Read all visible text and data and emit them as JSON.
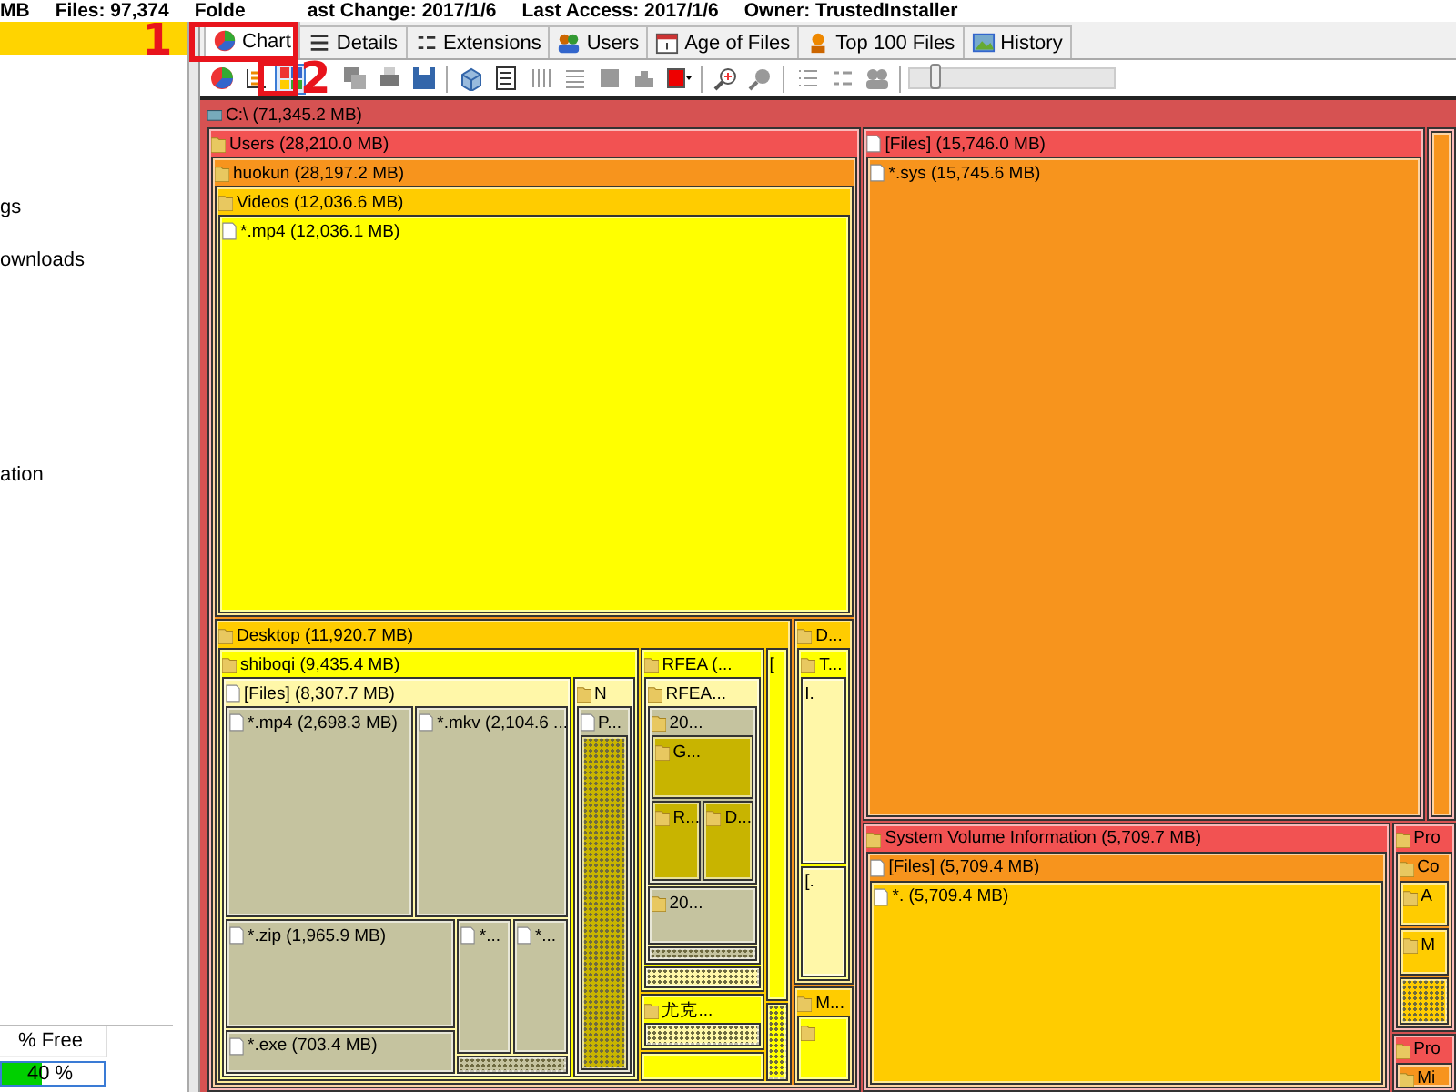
{
  "info_bar": [
    "MB",
    "Files: 97,374",
    "Folde",
    "ast Change: 2017/1/6",
    "Last Access: 2017/1/6",
    "Owner: TrustedInstaller"
  ],
  "sidebar": {
    "items": [
      {
        "selected": true
      },
      {
        "label": "gs",
        "selected": false
      },
      {
        "label": "ownloads",
        "selected": false
      },
      {
        "label": "ation",
        "selected": false
      }
    ]
  },
  "drives": {
    "column": "% Free",
    "rows": [
      {
        "reading": "40 %",
        "level": 0.4
      }
    ]
  },
  "tabs": [
    {
      "label": "Chart",
      "selected": true
    },
    {
      "label": "Details",
      "selected": false
    },
    {
      "label": "Extensions",
      "selected": false
    },
    {
      "label": "Users",
      "selected": false
    },
    {
      "label": "Age of Files",
      "selected": false
    },
    {
      "label": "Top 100 Files",
      "selected": false
    },
    {
      "label": "History",
      "selected": false
    }
  ],
  "toolbar": [
    {
      "kind": "button",
      "selected": false
    },
    {
      "kind": "button",
      "selected": false
    },
    {
      "kind": "button",
      "selected": true
    },
    {
      "kind": "button",
      "selected": false
    },
    {
      "kind": "button",
      "selected": false
    },
    {
      "kind": "button",
      "selected": false
    },
    {
      "kind": "separator"
    },
    {
      "kind": "button",
      "selected": false
    },
    {
      "kind": "button",
      "selected": false
    },
    {
      "kind": "button",
      "selected": false
    },
    {
      "kind": "button",
      "selected": false
    },
    {
      "kind": "button",
      "selected": false
    },
    {
      "kind": "button",
      "selected": false
    },
    {
      "kind": "button",
      "selected": false
    },
    {
      "kind": "separator"
    },
    {
      "kind": "button",
      "selected": false
    },
    {
      "kind": "button",
      "selected": false
    },
    {
      "kind": "separator"
    },
    {
      "kind": "button",
      "selected": false
    },
    {
      "kind": "button",
      "selected": false
    },
    {
      "kind": "button",
      "selected": false
    },
    {
      "kind": "separator"
    },
    {
      "kind": "slider",
      "level": 0.1
    }
  ],
  "treemap": {
    "label": "C:\\ (71,345.2 MB)",
    "kind": "drive",
    "children": [
      {
        "label": "Users (28,210.0 MB)",
        "kind": "folder",
        "children": [
          {
            "label": "huokun (28,197.2 MB)",
            "kind": "folder",
            "children": [
              {
                "label": "Videos (12,036.6 MB)",
                "kind": "folder",
                "children": [
                  {
                    "label": "*.mp4 (12,036.1 MB)",
                    "kind": "file"
                  }
                ]
              },
              {
                "label": "Desktop (11,920.7 MB)",
                "kind": "folder",
                "children": [
                  {
                    "label": "shiboqi (9,435.4 MB)",
                    "kind": "folder",
                    "children": [
                      {
                        "label": "[Files] (8,307.7 MB)",
                        "kind": "file",
                        "children": [
                          {
                            "label": "*.mp4 (2,698.3 MB)",
                            "kind": "file"
                          },
                          {
                            "label": "*.mkv (2,104.6 ...",
                            "kind": "file"
                          },
                          {
                            "label": "*.zip (1,965.9 MB)",
                            "kind": "file"
                          },
                          {
                            "label": "*.exe (703.4 MB)",
                            "kind": "file"
                          },
                          {
                            "label": "*...",
                            "kind": "file"
                          },
                          {
                            "label": "*...",
                            "kind": "file"
                          },
                          {
                            "kind": "cluster"
                          }
                        ]
                      },
                      {
                        "label": "N",
                        "kind": "folder",
                        "children": [
                          {
                            "label": "P...",
                            "kind": "file",
                            "children": [
                              {
                                "kind": "cluster"
                              }
                            ]
                          }
                        ]
                      }
                    ]
                  },
                  {
                    "label": "RFEA (...",
                    "kind": "folder",
                    "children": [
                      {
                        "label": "RFEA...",
                        "kind": "folder",
                        "children": [
                          {
                            "label": "20...",
                            "kind": "folder",
                            "children": [
                              {
                                "label": "G...",
                                "kind": "folder"
                              },
                              {
                                "label": "R...",
                                "kind": "folder"
                              },
                              {
                                "label": "D...",
                                "kind": "folder"
                              }
                            ]
                          },
                          {
                            "label": "20...",
                            "kind": "folder"
                          },
                          {
                            "kind": "cluster"
                          }
                        ]
                      },
                      {
                        "kind": "cluster"
                      }
                    ]
                  },
                  {
                    "label": "尤克...",
                    "kind": "folder",
                    "children": [
                      {
                        "kind": "cluster"
                      }
                    ]
                  },
                  {
                    "kind": "empty"
                  },
                  {
                    "label": "[",
                    "kind": "text"
                  },
                  {
                    "kind": "cluster"
                  }
                ]
              },
              {
                "label": "D...",
                "kind": "folder",
                "children": [
                  {
                    "label": "T...",
                    "kind": "folder",
                    "children": [
                      {
                        "label": "I.",
                        "kind": "text"
                      },
                      {
                        "label": "[.",
                        "kind": "text"
                      }
                    ]
                  }
                ]
              },
              {
                "label": "M...",
                "kind": "folder",
                "children": [
                  {
                    "kind": "folder"
                  }
                ]
              }
            ]
          }
        ]
      },
      {
        "label": "[Files] (15,746.0 MB)",
        "kind": "file",
        "children": [
          {
            "label": "*.sys (15,745.6 MB)",
            "kind": "file"
          }
        ]
      },
      {
        "label": "System Volume Information (5,709.7 MB)",
        "kind": "folder",
        "children": [
          {
            "label": "[Files] (5,709.4 MB)",
            "kind": "file",
            "children": [
              {
                "label": "*. (5,709.4 MB)",
                "kind": "file"
              }
            ]
          }
        ]
      },
      {
        "kind": "empty",
        "children": [
          {
            "kind": "empty"
          }
        ]
      },
      {
        "label": "Pro",
        "kind": "folder",
        "children": [
          {
            "label": "Co",
            "kind": "folder",
            "children": [
              {
                "label": "A",
                "kind": "folder"
              },
              {
                "label": "M",
                "kind": "folder"
              },
              {
                "kind": "cluster"
              }
            ]
          }
        ]
      },
      {
        "label": "Pro",
        "kind": "folder",
        "children": [
          {
            "label": "Mi",
            "kind": "folder"
          }
        ]
      }
    ]
  },
  "annotations": [
    {
      "label": "1"
    },
    {
      "label": "2"
    }
  ]
}
